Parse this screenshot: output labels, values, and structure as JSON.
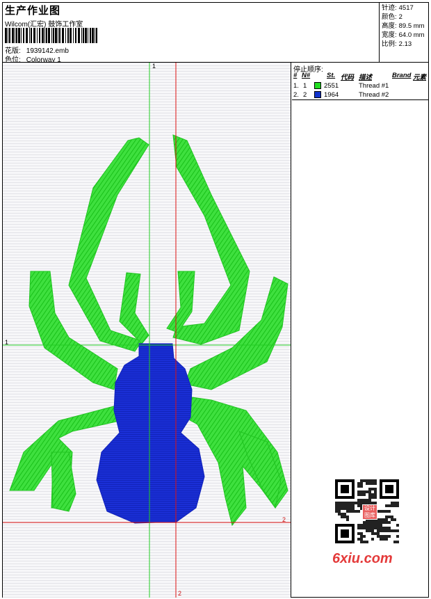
{
  "header": {
    "title": "生产作业图",
    "company": "Wilcom(汇宏) 鼓饰工作室",
    "design_label": "花版:",
    "design_value": "1939142.emb",
    "colorway_label": "色位:",
    "colorway_value": "Colorway 1"
  },
  "stats": [
    {
      "label": "针迹:",
      "value": "4517"
    },
    {
      "label": "颜色:",
      "value": "2"
    },
    {
      "label": "高度:",
      "value": "89.5 mm"
    },
    {
      "label": "宽度:",
      "value": "64.0 mm"
    },
    {
      "label": "比例:",
      "value": "2.13"
    }
  ],
  "stop_sequence": {
    "title": "停止顺序:",
    "columns": {
      "hash": "#",
      "n": "N#",
      "st": "St.",
      "code": "代码",
      "desc": "描述",
      "brand": "Brand",
      "element": "元素"
    },
    "rows": [
      {
        "index": "1.",
        "n": "1",
        "color": "#22dd22",
        "code": "2551",
        "desc": "Thread #1"
      },
      {
        "index": "2.",
        "n": "2",
        "color": "#1133cc",
        "code": "1964",
        "desc": "Thread #2"
      }
    ]
  },
  "axes": {
    "top_label": "1",
    "left_label": "1",
    "right_label": "2",
    "bottom_label": "2"
  },
  "colors": {
    "thread1": "#22dd22",
    "thread2": "#1133cc",
    "guide_green": "#22cc22",
    "guide_red": "#dd1111"
  },
  "watermark": {
    "text": "6xiu.com",
    "stamp": "设计图库"
  }
}
